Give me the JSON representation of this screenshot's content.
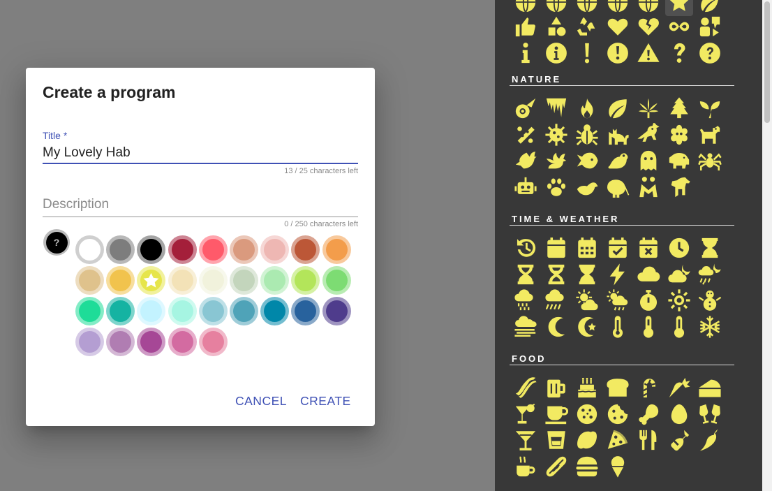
{
  "dialog": {
    "title": "Create a program",
    "title_field": {
      "label": "Title *",
      "value": "My Lovely Hab",
      "counter": "13 / 25 characters left"
    },
    "description_field": {
      "placeholder": "Description",
      "value": "",
      "counter": "0 / 250 characters left"
    },
    "selected_icon": {
      "name": "question-icon",
      "symbol": "?"
    },
    "colors": [
      "#ffffff",
      "#7d7d7d",
      "#000000",
      "#a41f3a",
      "#ff5a6a",
      "#da9a7e",
      "#eeb7b3",
      "#bc5737",
      "#f39d4b",
      "#dfc28c",
      "#f1c34d",
      "#e6e54b",
      "#f3e2b7",
      "#f1f2dc",
      "#c3d5bc",
      "#abeab1",
      "#b3e55a",
      "#7ddc73",
      "#1edc98",
      "#15b3a2",
      "#c3f3ff",
      "#a6f5e2",
      "#89c6d3",
      "#4fa3b8",
      "#0087a9",
      "#28629d",
      "#4f3c8c",
      "#b49ed2",
      "#b07db2",
      "#a64796",
      "#d36ba1",
      "#e6809f"
    ],
    "selected_color_index": 11,
    "buttons": {
      "cancel": "CANCEL",
      "create": "CREATE"
    }
  },
  "icon_panel": {
    "icon_color": "#f2ea62",
    "sections": [
      {
        "title": "NATURE",
        "icons": [
          "comet",
          "icicles",
          "fire",
          "leaf",
          "cannabis",
          "tree",
          "seedling",
          "bacteria",
          "virus",
          "bug",
          "cat",
          "crow",
          "spider-cell",
          "dog",
          "dove",
          "dragon",
          "fish",
          "frog",
          "ghost",
          "hippo",
          "spider",
          "robot",
          "paw",
          "otter",
          "kiwi",
          "people-hugging",
          "horse"
        ]
      },
      {
        "title": "TIME & WEATHER",
        "icons": [
          "history",
          "calendar",
          "calendar-days",
          "calendar-check",
          "calendar-xmark",
          "clock",
          "hourglass-full",
          "hourglass-start",
          "hourglass-half",
          "hourglass-end",
          "bolt",
          "cloud",
          "cloud-moon",
          "cloud-moon-rain",
          "cloud-showers",
          "cloud-rain",
          "cloud-sun",
          "cloud-sun-rain",
          "stopwatch",
          "sun",
          "snowman",
          "smog",
          "moon",
          "star-and-crescent",
          "thermometer-full",
          "thermometer-half",
          "thermometer-low",
          "snowflake"
        ]
      },
      {
        "title": "FOOD",
        "icons": [
          "bacon",
          "beer",
          "birthday-cake",
          "bread",
          "candy-cane",
          "carrot",
          "cheese",
          "cocktail",
          "coffee",
          "cookie",
          "cookie-bite",
          "drumstick",
          "egg",
          "glass-cheers",
          "martini",
          "whiskey",
          "lemon",
          "pizza",
          "utensils",
          "wine-bottle",
          "pepper",
          "mug-hot",
          "hotdog",
          "hamburger",
          "ice-cream"
        ]
      }
    ]
  }
}
